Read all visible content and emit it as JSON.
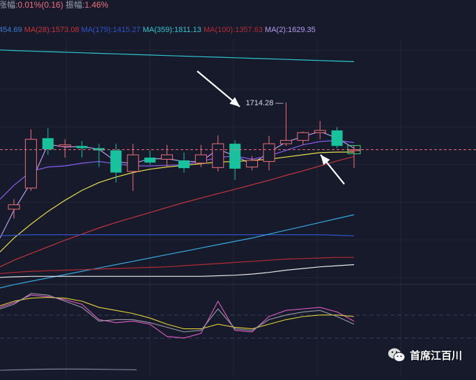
{
  "colors": {
    "background": "#161a2b",
    "grid": "#232838",
    "candle_up": "#f0707a",
    "candle_down": "#17c29c",
    "arrow": "#ffffff",
    "current_price_line": "#f0707a"
  },
  "header": {
    "change_label": "涨幅:",
    "change_value": "0.01%(0.16)",
    "amplitude_label": "振幅:",
    "amplitude_value": "1.46%"
  },
  "ma_legend": [
    {
      "text": "454.69",
      "color": "#3b7bd1"
    },
    {
      "text": "MA(28):1573.08",
      "color": "#c8343a"
    },
    {
      "text": "MA(179):1415.27",
      "color": "#2f55c8"
    },
    {
      "text": "MA(359):1811.13",
      "color": "#2ec6d1"
    },
    {
      "text": "MA(100):1357.63",
      "color": "#b52b33"
    },
    {
      "text": "MA(2):1629.35",
      "color": "#b79cf0"
    }
  ],
  "annotation": {
    "peak_label": "1714.28"
  },
  "watermark": {
    "text": "首席江百川",
    "icon": "wechat-icon"
  },
  "chart_data": {
    "type": "candlestick",
    "description_series": "daily candles with moving-average overlays and a lower oscillator panel",
    "ylim": [
      1390,
      1830
    ],
    "candles": [
      {
        "o": 1522,
        "h": 1540,
        "l": 1505,
        "c": 1530
      },
      {
        "o": 1560,
        "h": 1666,
        "l": 1555,
        "c": 1648
      },
      {
        "o": 1650,
        "h": 1668,
        "l": 1620,
        "c": 1630
      },
      {
        "o": 1635,
        "h": 1648,
        "l": 1615,
        "c": 1638
      },
      {
        "o": 1636,
        "h": 1645,
        "l": 1615,
        "c": 1632
      },
      {
        "o": 1632,
        "h": 1640,
        "l": 1598,
        "c": 1628
      },
      {
        "o": 1628,
        "h": 1640,
        "l": 1570,
        "c": 1588
      },
      {
        "o": 1590,
        "h": 1640,
        "l": 1555,
        "c": 1620
      },
      {
        "o": 1615,
        "h": 1628,
        "l": 1602,
        "c": 1606
      },
      {
        "o": 1612,
        "h": 1638,
        "l": 1598,
        "c": 1620
      },
      {
        "o": 1610,
        "h": 1624,
        "l": 1588,
        "c": 1596
      },
      {
        "o": 1605,
        "h": 1638,
        "l": 1598,
        "c": 1620
      },
      {
        "o": 1597,
        "h": 1655,
        "l": 1590,
        "c": 1640
      },
      {
        "o": 1640,
        "h": 1646,
        "l": 1575,
        "c": 1595
      },
      {
        "o": 1598,
        "h": 1618,
        "l": 1592,
        "c": 1610
      },
      {
        "o": 1608,
        "h": 1654,
        "l": 1592,
        "c": 1640
      },
      {
        "o": 1640,
        "h": 1714.28,
        "l": 1636,
        "c": 1646
      },
      {
        "o": 1646,
        "h": 1662,
        "l": 1638,
        "c": 1660
      },
      {
        "o": 1660,
        "h": 1681,
        "l": 1648,
        "c": 1664
      },
      {
        "o": 1664,
        "h": 1670,
        "l": 1632,
        "c": 1636
      },
      {
        "o": 1629,
        "h": 1637,
        "l": 1596,
        "c": 1629.35
      }
    ],
    "moving_averages": [
      {
        "name": "MA(359)",
        "color": "#2ec6d1",
        "values": [
          1808,
          1807,
          1806,
          1805,
          1804,
          1803,
          1802,
          1801,
          1800,
          1799,
          1798,
          1797,
          1796,
          1795,
          1794,
          1793,
          1792,
          1791,
          1790,
          1789,
          1788
        ]
      },
      {
        "name": "MA(2)",
        "color": "#b79cf0",
        "values": [
          1520,
          1570,
          1639,
          1634,
          1635,
          1630,
          1608,
          1604,
          1613,
          1613,
          1608,
          1608,
          1630,
          1618,
          1603,
          1625,
          1643,
          1653,
          1662,
          1650,
          1632
        ]
      },
      {
        "name": "MA(5)",
        "color": "#8a5cf0",
        "values": [
          1565,
          1590,
          1598,
          1600,
          1605,
          1608,
          1604,
          1600,
          1600,
          1601,
          1602,
          1608,
          1615,
          1618,
          1612,
          1618,
          1628,
          1638,
          1644,
          1646,
          1642
        ]
      },
      {
        "name": "MA(10)",
        "color": "#e8e04a",
        "values": [
          1470,
          1495,
          1518,
          1538,
          1556,
          1570,
          1580,
          1588,
          1594,
          1598,
          1601,
          1604,
          1607,
          1608,
          1610,
          1612,
          1616,
          1620,
          1624,
          1625,
          1625
        ]
      },
      {
        "name": "MA(28)",
        "color": "#c8343a",
        "values": [
          1430,
          1442,
          1454,
          1466,
          1477,
          1488,
          1498,
          1507,
          1516,
          1525,
          1534,
          1542,
          1550,
          1558,
          1566,
          1574,
          1583,
          1591,
          1600,
          1609,
          1617
        ]
      },
      {
        "name": "MA(179)",
        "color": "#2f55c8",
        "values": [
          1475,
          1476,
          1476,
          1476,
          1476,
          1476,
          1476,
          1476,
          1476,
          1476,
          1476,
          1476,
          1476,
          1476,
          1476,
          1476,
          1476,
          1476,
          1476,
          1475,
          1474
        ]
      },
      {
        "name": "MA(60)",
        "color": "#36a9e0",
        "values": [
          1386,
          1392,
          1398,
          1404,
          1410,
          1416,
          1422,
          1428,
          1434,
          1440,
          1446,
          1452,
          1458,
          1464,
          1470,
          1477,
          1484,
          1491,
          1498,
          1505,
          1512
        ]
      },
      {
        "name": "MA(100)",
        "color": "#b52b33",
        "values": [
          1408,
          1410,
          1411,
          1412,
          1413,
          1414,
          1415,
          1416,
          1417,
          1418,
          1420,
          1422,
          1424,
          1426,
          1428,
          1430,
          1432,
          1433,
          1434,
          1435,
          1435
        ]
      },
      {
        "name": "MA(250)",
        "color": "#e8e8e8",
        "values": [
          1400,
          1401,
          1401,
          1401,
          1401,
          1401,
          1401,
          1401,
          1401,
          1401,
          1401,
          1401,
          1402,
          1403,
          1405,
          1408,
          1412,
          1415,
          1418,
          1420,
          1422
        ]
      }
    ],
    "oscillator": [
      {
        "name": "K",
        "color": "#e55cc8",
        "values": [
          78,
          88,
          86,
          82,
          76,
          56,
          52,
          54,
          50,
          34,
          32,
          38,
          80,
          42,
          40,
          60,
          68,
          70,
          72,
          66,
          54
        ]
      },
      {
        "name": "D",
        "color": "#e6d33a",
        "values": [
          80,
          84,
          85,
          84,
          80,
          72,
          68,
          64,
          58,
          50,
          44,
          44,
          50,
          46,
          44,
          50,
          56,
          60,
          62,
          62,
          60
        ]
      },
      {
        "name": "J",
        "color": "#9a9aa5",
        "values": [
          76,
          90,
          88,
          80,
          72,
          54,
          56,
          56,
          52,
          46,
          40,
          42,
          70,
          44,
          42,
          56,
          62,
          66,
          68,
          60,
          50
        ]
      }
    ],
    "lower_series": [
      {
        "name": "lower-avg",
        "color": "#8a8aa0",
        "values": [
          40,
          42,
          44,
          45,
          45,
          44,
          43,
          42
        ]
      }
    ]
  }
}
